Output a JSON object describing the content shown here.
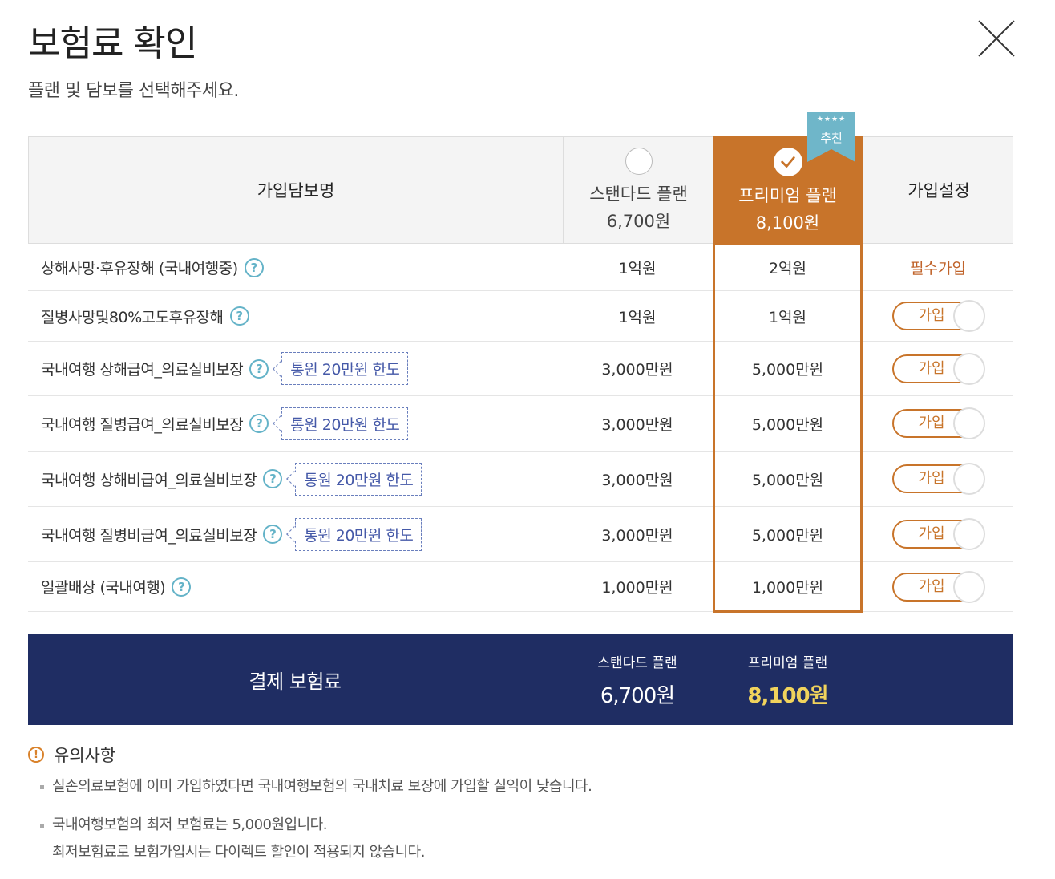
{
  "title": "보험료 확인",
  "subtitle": "플랜 및 담보를 선택해주세요.",
  "header": {
    "coverage_col": "가입담보명",
    "settings_col": "가입설정",
    "standard": {
      "name": "스탠다드 플랜",
      "price": "6,700원"
    },
    "premium": {
      "name": "프리미엄 플랜",
      "price": "8,100원"
    },
    "recommend_badge": "추천",
    "recommend_stars": "★★★★"
  },
  "rows": [
    {
      "name": "상해사망·후유장해 (국내여행중)",
      "limit": "",
      "standard": "1억원",
      "premium": "2억원",
      "setting": "필수가입"
    },
    {
      "name": "질병사망및80%고도후유장해",
      "limit": "",
      "standard": "1억원",
      "premium": "1억원",
      "setting": "가입"
    },
    {
      "name": "국내여행 상해급여_의료실비보장",
      "limit": "통원 20만원 한도",
      "standard": "3,000만원",
      "premium": "5,000만원",
      "setting": "가입"
    },
    {
      "name": "국내여행 질병급여_의료실비보장",
      "limit": "통원 20만원 한도",
      "standard": "3,000만원",
      "premium": "5,000만원",
      "setting": "가입"
    },
    {
      "name": "국내여행 상해비급여_의료실비보장",
      "limit": "통원 20만원 한도",
      "standard": "3,000만원",
      "premium": "5,000만원",
      "setting": "가입"
    },
    {
      "name": "국내여행 질병비급여_의료실비보장",
      "limit": "통원 20만원 한도",
      "standard": "3,000만원",
      "premium": "5,000만원",
      "setting": "가입"
    },
    {
      "name": "일괄배상 (국내여행)",
      "limit": "",
      "standard": "1,000만원",
      "premium": "1,000만원",
      "setting": "가입"
    }
  ],
  "help_icon": "?",
  "total": {
    "title": "결제 보험료",
    "standard_name": "스탠다드 플랜",
    "standard_price": "6,700원",
    "premium_name": "프리미엄 플랜",
    "premium_price": "8,100원"
  },
  "notice": {
    "title": "유의사항",
    "items": [
      [
        "실손의료보험에 이미 가입하였다면 국내여행보험의 국내치료 보장에 가입할 실익이 낮습니다."
      ],
      [
        "국내여행보험의 최저 보험료는 5,000원입니다.",
        "최저보험료로 보험가입시는 다이렉트 할인이 적용되지 않습니다."
      ]
    ]
  },
  "colors": {
    "accent": "#c8742a",
    "navy": "#1f2d63",
    "help": "#64b3c8",
    "limit": "#4559a8",
    "highlight_price": "#f1d35c"
  }
}
